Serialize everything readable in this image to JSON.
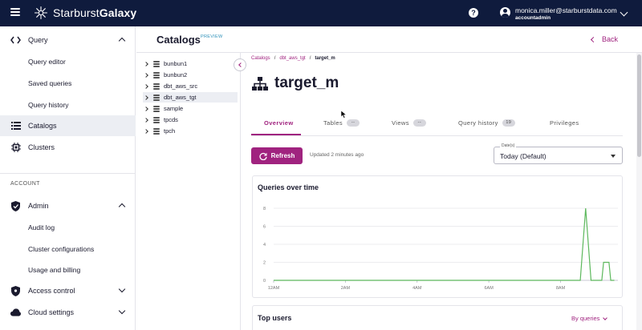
{
  "topbar": {
    "brand_light": "Starburst",
    "brand_bold": "Galaxy",
    "user_email": "monica.miller@starburstdata.com",
    "user_role": "accountadmin"
  },
  "sidebar": {
    "query": "Query",
    "query_editor": "Query editor",
    "saved_queries": "Saved queries",
    "query_history": "Query history",
    "catalogs": "Catalogs",
    "clusters": "Clusters",
    "section_account": "ACCOUNT",
    "admin": "Admin",
    "audit_log": "Audit log",
    "cluster_configurations": "Cluster configurations",
    "usage_billing": "Usage and billing",
    "access_control": "Access control",
    "cloud_settings": "Cloud settings"
  },
  "header": {
    "title": "Catalogs",
    "badge": "PREVIEW",
    "back": "Back"
  },
  "tree": {
    "items": [
      "bunbun1",
      "bunbun2",
      "dbt_aws_src",
      "dbt_aws_tgt",
      "sample",
      "tpcds",
      "tpch"
    ]
  },
  "breadcrumb": {
    "root": "Catalogs",
    "catalog": "dbt_aws_tgt",
    "schema": "target_m"
  },
  "detail": {
    "title": "target_m",
    "refresh": "Refresh",
    "updated": "Updated 2 minutes ago",
    "date_label": "Date(s)",
    "date_value": "Today (Default)"
  },
  "tabs": [
    {
      "label": "Overview",
      "count": ""
    },
    {
      "label": "Tables",
      "count": "--"
    },
    {
      "label": "Views",
      "count": "--"
    },
    {
      "label": "Query history",
      "count": "19"
    },
    {
      "label": "Privileges",
      "count": ""
    }
  ],
  "card_queries": {
    "title": "Queries over time"
  },
  "card_users": {
    "title": "Top users",
    "sort": "By queries"
  },
  "colors": {
    "topbar": "#0f1b3d",
    "accent": "#a0237f",
    "series": "#5cb85c"
  },
  "chart_data": {
    "type": "line",
    "title": "Queries over time",
    "xlabel": "",
    "ylabel": "",
    "ylim": [
      0,
      8
    ],
    "yticks": [
      0,
      2,
      4,
      6,
      8
    ],
    "xticks": [
      "12AM",
      "2AM",
      "4AM",
      "6AM",
      "8AM"
    ],
    "xrange_hours": [
      0,
      9.6
    ],
    "series": [
      {
        "x_hours": [
          0,
          8.55,
          8.7,
          8.85,
          9.0,
          9.05,
          9.1,
          9.15,
          9.2,
          9.25,
          9.3,
          9.35,
          9.4,
          9.45,
          9.5
        ],
        "values": [
          0,
          0,
          8,
          0,
          0,
          0,
          0,
          0,
          2,
          2,
          2,
          2,
          0,
          0,
          0
        ]
      }
    ]
  }
}
